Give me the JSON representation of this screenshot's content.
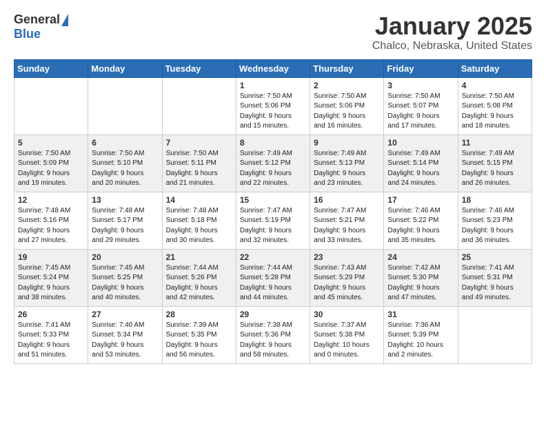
{
  "header": {
    "logo_general": "General",
    "logo_blue": "Blue",
    "title": "January 2025",
    "location": "Chalco, Nebraska, United States"
  },
  "weekdays": [
    "Sunday",
    "Monday",
    "Tuesday",
    "Wednesday",
    "Thursday",
    "Friday",
    "Saturday"
  ],
  "weeks": [
    [
      {
        "day": "",
        "info": ""
      },
      {
        "day": "",
        "info": ""
      },
      {
        "day": "",
        "info": ""
      },
      {
        "day": "1",
        "info": "Sunrise: 7:50 AM\nSunset: 5:06 PM\nDaylight: 9 hours\nand 15 minutes."
      },
      {
        "day": "2",
        "info": "Sunrise: 7:50 AM\nSunset: 5:06 PM\nDaylight: 9 hours\nand 16 minutes."
      },
      {
        "day": "3",
        "info": "Sunrise: 7:50 AM\nSunset: 5:07 PM\nDaylight: 9 hours\nand 17 minutes."
      },
      {
        "day": "4",
        "info": "Sunrise: 7:50 AM\nSunset: 5:08 PM\nDaylight: 9 hours\nand 18 minutes."
      }
    ],
    [
      {
        "day": "5",
        "info": "Sunrise: 7:50 AM\nSunset: 5:09 PM\nDaylight: 9 hours\nand 19 minutes."
      },
      {
        "day": "6",
        "info": "Sunrise: 7:50 AM\nSunset: 5:10 PM\nDaylight: 9 hours\nand 20 minutes."
      },
      {
        "day": "7",
        "info": "Sunrise: 7:50 AM\nSunset: 5:11 PM\nDaylight: 9 hours\nand 21 minutes."
      },
      {
        "day": "8",
        "info": "Sunrise: 7:49 AM\nSunset: 5:12 PM\nDaylight: 9 hours\nand 22 minutes."
      },
      {
        "day": "9",
        "info": "Sunrise: 7:49 AM\nSunset: 5:13 PM\nDaylight: 9 hours\nand 23 minutes."
      },
      {
        "day": "10",
        "info": "Sunrise: 7:49 AM\nSunset: 5:14 PM\nDaylight: 9 hours\nand 24 minutes."
      },
      {
        "day": "11",
        "info": "Sunrise: 7:49 AM\nSunset: 5:15 PM\nDaylight: 9 hours\nand 26 minutes."
      }
    ],
    [
      {
        "day": "12",
        "info": "Sunrise: 7:48 AM\nSunset: 5:16 PM\nDaylight: 9 hours\nand 27 minutes."
      },
      {
        "day": "13",
        "info": "Sunrise: 7:48 AM\nSunset: 5:17 PM\nDaylight: 9 hours\nand 29 minutes."
      },
      {
        "day": "14",
        "info": "Sunrise: 7:48 AM\nSunset: 5:18 PM\nDaylight: 9 hours\nand 30 minutes."
      },
      {
        "day": "15",
        "info": "Sunrise: 7:47 AM\nSunset: 5:19 PM\nDaylight: 9 hours\nand 32 minutes."
      },
      {
        "day": "16",
        "info": "Sunrise: 7:47 AM\nSunset: 5:21 PM\nDaylight: 9 hours\nand 33 minutes."
      },
      {
        "day": "17",
        "info": "Sunrise: 7:46 AM\nSunset: 5:22 PM\nDaylight: 9 hours\nand 35 minutes."
      },
      {
        "day": "18",
        "info": "Sunrise: 7:46 AM\nSunset: 5:23 PM\nDaylight: 9 hours\nand 36 minutes."
      }
    ],
    [
      {
        "day": "19",
        "info": "Sunrise: 7:45 AM\nSunset: 5:24 PM\nDaylight: 9 hours\nand 38 minutes."
      },
      {
        "day": "20",
        "info": "Sunrise: 7:45 AM\nSunset: 5:25 PM\nDaylight: 9 hours\nand 40 minutes."
      },
      {
        "day": "21",
        "info": "Sunrise: 7:44 AM\nSunset: 5:26 PM\nDaylight: 9 hours\nand 42 minutes."
      },
      {
        "day": "22",
        "info": "Sunrise: 7:44 AM\nSunset: 5:28 PM\nDaylight: 9 hours\nand 44 minutes."
      },
      {
        "day": "23",
        "info": "Sunrise: 7:43 AM\nSunset: 5:29 PM\nDaylight: 9 hours\nand 45 minutes."
      },
      {
        "day": "24",
        "info": "Sunrise: 7:42 AM\nSunset: 5:30 PM\nDaylight: 9 hours\nand 47 minutes."
      },
      {
        "day": "25",
        "info": "Sunrise: 7:41 AM\nSunset: 5:31 PM\nDaylight: 9 hours\nand 49 minutes."
      }
    ],
    [
      {
        "day": "26",
        "info": "Sunrise: 7:41 AM\nSunset: 5:33 PM\nDaylight: 9 hours\nand 51 minutes."
      },
      {
        "day": "27",
        "info": "Sunrise: 7:40 AM\nSunset: 5:34 PM\nDaylight: 9 hours\nand 53 minutes."
      },
      {
        "day": "28",
        "info": "Sunrise: 7:39 AM\nSunset: 5:35 PM\nDaylight: 9 hours\nand 56 minutes."
      },
      {
        "day": "29",
        "info": "Sunrise: 7:38 AM\nSunset: 5:36 PM\nDaylight: 9 hours\nand 58 minutes."
      },
      {
        "day": "30",
        "info": "Sunrise: 7:37 AM\nSunset: 5:38 PM\nDaylight: 10 hours\nand 0 minutes."
      },
      {
        "day": "31",
        "info": "Sunrise: 7:36 AM\nSunset: 5:39 PM\nDaylight: 10 hours\nand 2 minutes."
      },
      {
        "day": "",
        "info": ""
      }
    ]
  ]
}
